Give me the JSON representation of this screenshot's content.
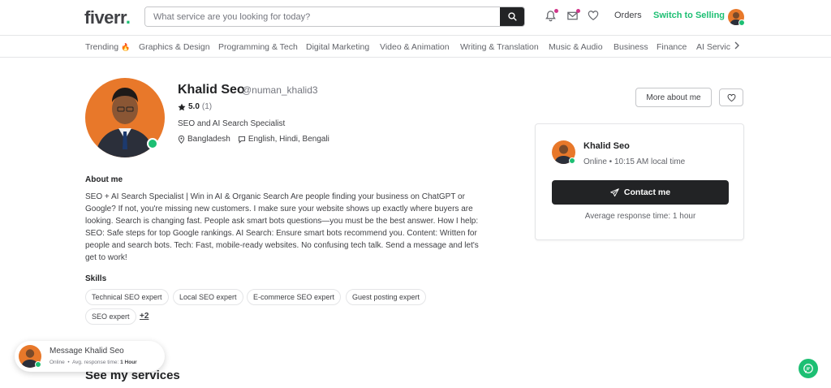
{
  "brand": {
    "name": "fiverr",
    "dot": "."
  },
  "search": {
    "placeholder": "What service are you looking for today?"
  },
  "header": {
    "orders": "Orders",
    "switch_selling": "Switch to Selling"
  },
  "categories": [
    "Trending",
    "Graphics & Design",
    "Programming & Tech",
    "Digital Marketing",
    "Video & Animation",
    "Writing & Translation",
    "Music & Audio",
    "Business",
    "Finance",
    "AI Services"
  ],
  "trending_emoji": "🔥",
  "profile": {
    "name": "Khalid Seo",
    "username": "@numan_khalid3",
    "rating": "5.0",
    "rating_count": "(1)",
    "title": "SEO and AI Search Specialist",
    "location": "Bangladesh",
    "languages": "English, Hindi, Bengali",
    "more_about_btn": "More about me"
  },
  "contact_card": {
    "name": "Khalid Seo",
    "status": "Online • 10:15 AM local time",
    "contact_btn": "Contact me",
    "response": "Average response time: 1 hour"
  },
  "about": {
    "heading": "About me",
    "text": "SEO + AI Search Specialist | Win in AI & Organic Search Are people finding your business on ChatGPT or Google? If not, you're missing new customers. I make sure your website shows up exactly where buyers are looking. Search is changing fast. People ask smart bots questions—you must be the best answer. How I help: SEO: Safe steps for top Google rankings. AI Search: Ensure smart bots recommend you. Content: Written for people and search bots. Tech: Fast, mobile-ready websites. No confusing tech talk. Send a message and let's get to work!"
  },
  "skills": {
    "heading": "Skills",
    "items": [
      "Technical SEO expert",
      "Local SEO expert",
      "E-commerce SEO expert",
      "Guest posting expert",
      "SEO expert"
    ],
    "more": "+2"
  },
  "message_popup": {
    "title": "Message Khalid Seo",
    "status": "Online",
    "sep": "•",
    "resp_label": "Avg. response time:",
    "resp_value": "1 Hour"
  },
  "services": {
    "heading": "See my services"
  },
  "colors": {
    "accent": "#1dbf73",
    "dark": "#222325",
    "avatar_bg": "#e8782a",
    "notify": "#d0368a"
  },
  "icons": [
    "search-icon",
    "bell-icon",
    "mail-icon",
    "heart-icon",
    "star-icon",
    "location-icon",
    "speech-bubble-icon",
    "send-icon",
    "chat-icon",
    "chevron-right-icon"
  ]
}
